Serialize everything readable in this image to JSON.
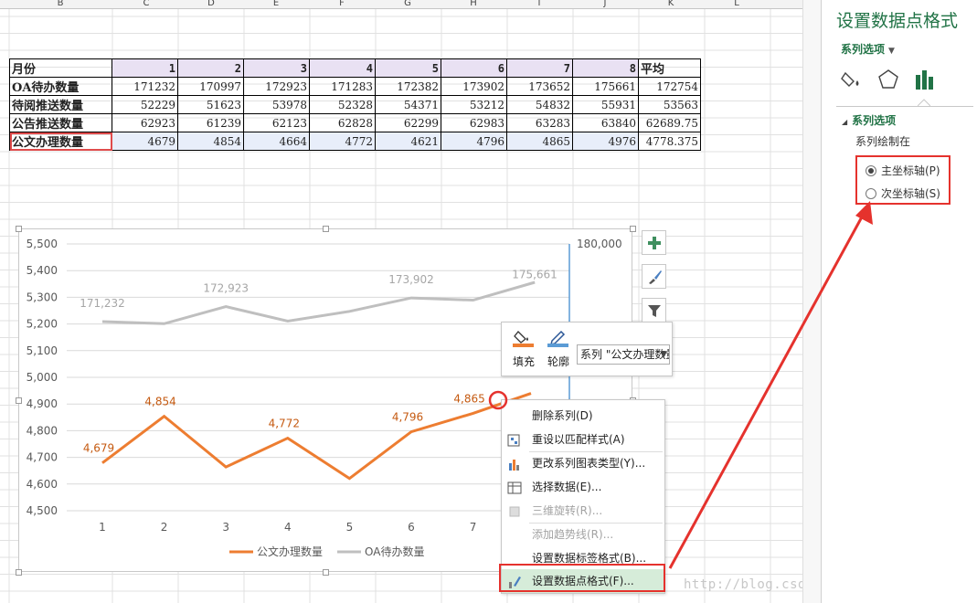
{
  "column_headers": [
    "B",
    "C",
    "D",
    "E",
    "F",
    "G",
    "H",
    "I",
    "J",
    "K",
    "L"
  ],
  "table": {
    "header_row": {
      "label": "月份",
      "months": [
        "1",
        "2",
        "3",
        "4",
        "5",
        "6",
        "7",
        "8"
      ],
      "avg_label": "平均"
    },
    "rows": [
      {
        "label": "OA待办数量",
        "values": [
          "171232",
          "170997",
          "172923",
          "171283",
          "172382",
          "173902",
          "173652",
          "175661"
        ],
        "avg": "172754"
      },
      {
        "label": "待阅推送数量",
        "values": [
          "52229",
          "51623",
          "53978",
          "52328",
          "54371",
          "53212",
          "54832",
          "55931"
        ],
        "avg": "53563"
      },
      {
        "label": "公告推送数量",
        "values": [
          "62923",
          "61239",
          "62123",
          "62828",
          "62299",
          "62983",
          "63283",
          "63840"
        ],
        "avg": "62689.75"
      },
      {
        "label": "公文办理数量",
        "values": [
          "4679",
          "4854",
          "4664",
          "4772",
          "4621",
          "4796",
          "4865",
          "4976"
        ],
        "avg": "4778.375"
      }
    ]
  },
  "chart_data": {
    "type": "line",
    "categories": [
      "1",
      "2",
      "3",
      "4",
      "5",
      "6",
      "7",
      "8"
    ],
    "visible_x_ticks": [
      "1",
      "2",
      "3",
      "4",
      "5",
      "6",
      "7"
    ],
    "primary_y_ticks": [
      "5,500",
      "5,400",
      "5,300",
      "5,200",
      "5,100",
      "5,000",
      "4,900",
      "4,800",
      "4,700",
      "4,600",
      "4,500"
    ],
    "ylim": [
      4500,
      5500
    ],
    "secondary_y_visible_tick": "180,000",
    "series": [
      {
        "name": "公文办理数量",
        "axis": "primary",
        "color": "#ED7D31",
        "values": [
          4679,
          4854,
          4664,
          4772,
          4621,
          4796,
          4865,
          4976
        ],
        "data_labels": [
          "4,679",
          "4,854",
          "",
          "4,772",
          "",
          "4,796",
          "4,865",
          ""
        ]
      },
      {
        "name": "OA待办数量",
        "axis": "secondary",
        "color": "#BFBFBF",
        "values": [
          171232,
          170997,
          172923,
          171283,
          172382,
          173902,
          173652,
          175661
        ],
        "data_labels": [
          "171,232",
          "",
          "172,923",
          "",
          "",
          "173,902",
          "",
          "175,661"
        ]
      }
    ],
    "legend": [
      "公文办理数量",
      "OA待办数量"
    ],
    "legend_position": "bottom"
  },
  "chart_buttons": {
    "elements": "plus-icon",
    "styles": "brush-icon",
    "filter": "filter-icon"
  },
  "mini_toolbar": {
    "fill_label": "填充",
    "outline_label": "轮廓",
    "series_select_value": "系列 \"公文办理数量\""
  },
  "context_menu": [
    {
      "label": "删除系列(D)",
      "enabled": true,
      "icon": ""
    },
    {
      "label": "重设以匹配样式(A)",
      "enabled": true,
      "icon": "reset-style-icon"
    },
    {
      "label": "更改系列图表类型(Y)...",
      "enabled": true,
      "icon": "chart-type-icon"
    },
    {
      "label": "选择数据(E)...",
      "enabled": true,
      "icon": "select-data-icon"
    },
    {
      "label": "三维旋转(R)...",
      "enabled": false,
      "icon": "rotate-3d-icon"
    },
    {
      "label": "添加趋势线(R)...",
      "enabled": false,
      "icon": ""
    },
    {
      "label": "设置数据标签格式(B)...",
      "enabled": true,
      "icon": ""
    },
    {
      "label": "设置数据点格式(F)...",
      "enabled": true,
      "icon": "format-point-icon",
      "highlighted": true
    }
  ],
  "pane": {
    "title": "设置数据点格式",
    "options_dropdown": "系列选项",
    "section_title": "系列选项",
    "plot_on_label": "系列绘制在",
    "radios": [
      {
        "label": "主坐标轴(P)",
        "checked": true
      },
      {
        "label": "次坐标轴(S)",
        "checked": false
      }
    ]
  },
  "watermark": "http://blog.csdn.net/Zencengl.iu",
  "colors": {
    "accent": "#217346",
    "orange": "#ED7D31",
    "gray": "#BFBFBF",
    "red": "#E5322D"
  }
}
